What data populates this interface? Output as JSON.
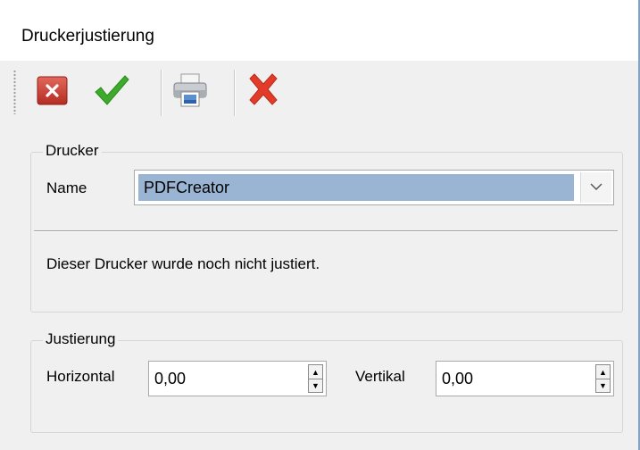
{
  "window": {
    "title": "Druckerjustierung"
  },
  "toolbar": {
    "buttons": [
      {
        "icon": "close-window-icon"
      },
      {
        "icon": "checkmark-icon"
      },
      {
        "icon": "printer-icon"
      },
      {
        "icon": "cancel-x-icon"
      }
    ]
  },
  "printer_group": {
    "legend": "Drucker",
    "name_label": "Name",
    "selected_printer": "PDFCreator",
    "status_text": "Dieser Drucker wurde noch nicht justiert."
  },
  "adjust_group": {
    "legend": "Justierung",
    "horizontal_label": "Horizontal",
    "horizontal_value": "0,00",
    "vertical_label": "Vertikal",
    "vertical_value": "0,00"
  },
  "colors": {
    "selection": "#9ab4d3",
    "red_button": "#c8382b",
    "green_check": "#3daa2c",
    "red_x": "#e33b2a"
  }
}
